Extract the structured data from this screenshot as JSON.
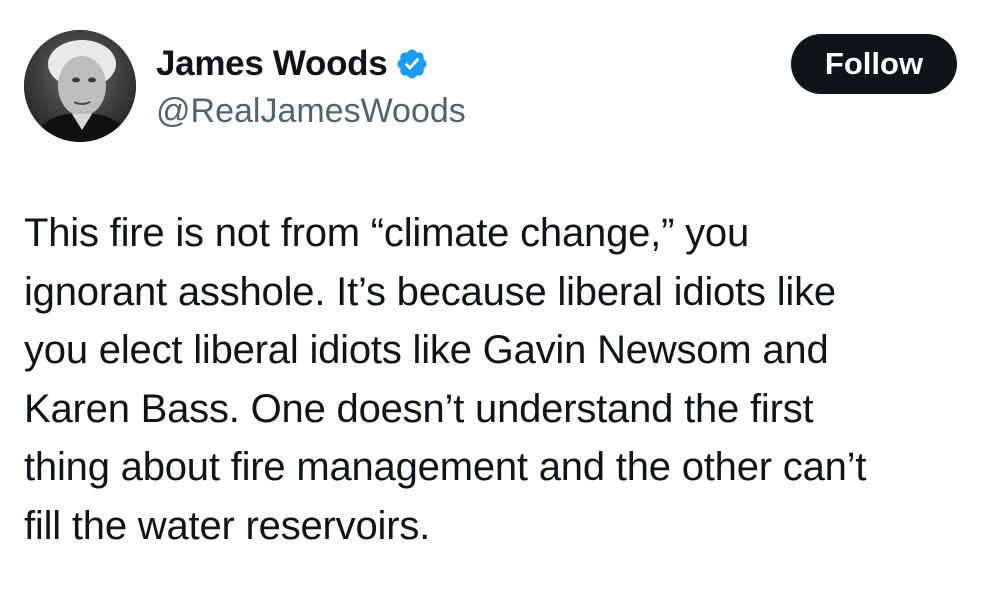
{
  "author": {
    "display_name": "James Woods",
    "handle": "@RealJamesWoods",
    "verified": true,
    "verified_icon": "verified-badge-icon",
    "verified_color": "#1d9bf0"
  },
  "follow_button": {
    "label": "Follow",
    "background": "#0f1419",
    "text_color": "#ffffff"
  },
  "tweet": {
    "lines": [
      "This fire is not from “climate change,” you",
      "ignorant asshole. It’s because liberal idiots like",
      "you elect liberal idiots like Gavin Newsom and",
      "Karen Bass. One doesn’t understand the first",
      "thing about fire management and the other can’t",
      "fill the water reservoirs."
    ]
  },
  "colors": {
    "text_primary": "#0f1419",
    "text_secondary": "#536471",
    "background": "#ffffff"
  }
}
